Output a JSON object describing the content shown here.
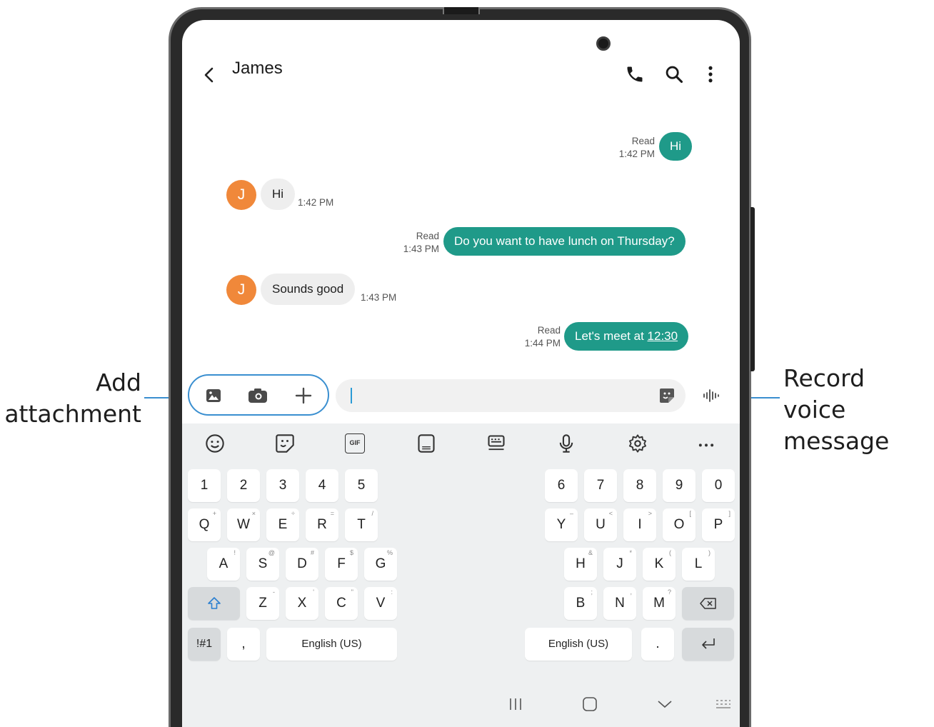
{
  "callouts": {
    "add_attachment_line1": "Add",
    "add_attachment_line2": "attachment",
    "record_voice_line1": "Record voice",
    "record_voice_line2": "message"
  },
  "header": {
    "title": "James",
    "icons": [
      "back-arrow-icon",
      "phone-icon",
      "search-icon",
      "more-options-icon"
    ]
  },
  "avatar_letter": "J",
  "messages": [
    {
      "direction": "out",
      "text": "Hi",
      "status": "Read",
      "time": "1:42 PM"
    },
    {
      "direction": "in",
      "text": "Hi",
      "time": "1:42 PM"
    },
    {
      "direction": "out",
      "text": "Do you want to have lunch on Thursday?",
      "status": "Read",
      "time": "1:43 PM"
    },
    {
      "direction": "in",
      "text": "Sounds good",
      "time": "1:43 PM"
    },
    {
      "direction": "out",
      "text_prefix": "Let's meet at ",
      "text_link": "12:30",
      "status": "Read",
      "time": "1:44 PM"
    }
  ],
  "input_bar": {
    "value": "",
    "icons": [
      "gallery-icon",
      "camera-icon",
      "add-icon",
      "sticker-icon",
      "voice-record-icon"
    ]
  },
  "keyboard": {
    "toolbar": [
      "emoji-icon",
      "sticker-icon",
      "gif-icon",
      "keyboard-mode-icon",
      "keyboard-layout-icon",
      "microphone-icon",
      "settings-icon",
      "more-icon"
    ],
    "gif_label": "GIF",
    "left": {
      "numbers": [
        "1",
        "2",
        "3",
        "4",
        "5"
      ],
      "row1": [
        "Q",
        "W",
        "E",
        "R",
        "T"
      ],
      "row2": [
        "A",
        "S",
        "D",
        "F",
        "G"
      ],
      "row3": [
        "Z",
        "X",
        "C",
        "V"
      ],
      "symbols_key": "!#1",
      "comma_key": ",",
      "space_label": "English (US)"
    },
    "right": {
      "numbers": [
        "6",
        "7",
        "8",
        "9",
        "0"
      ],
      "row1": [
        "Y",
        "U",
        "I",
        "O",
        "P"
      ],
      "row2": [
        "H",
        "J",
        "K",
        "L"
      ],
      "row3": [
        "B",
        "N",
        "M"
      ],
      "space_label": "English (US)",
      "period_key": "."
    },
    "hints": {
      "q": "+",
      "w": "×",
      "e": "÷",
      "r": "=",
      "t": "/",
      "a": "!",
      "s": "@",
      "d": "#",
      "f": "$",
      "g": "%",
      "z": "-",
      "x": "'",
      "c": "\"",
      "v": ":",
      "y": "–",
      "u": "<",
      "i": ">",
      "o": "[",
      "p": "]",
      "h": "&",
      "j": "*",
      "k": "(",
      "l": ")",
      "b": ";",
      "n": ",",
      "m": "?"
    }
  },
  "navbar": {
    "icons": [
      "recents-icon",
      "home-icon",
      "hide-keyboard-icon",
      "keyboard-switch-icon"
    ]
  },
  "colors": {
    "accent": "#1f9a89",
    "avatar": "#f0883a",
    "callout_line": "#3a8fd0",
    "keyboard_bg": "#eef0f1"
  }
}
